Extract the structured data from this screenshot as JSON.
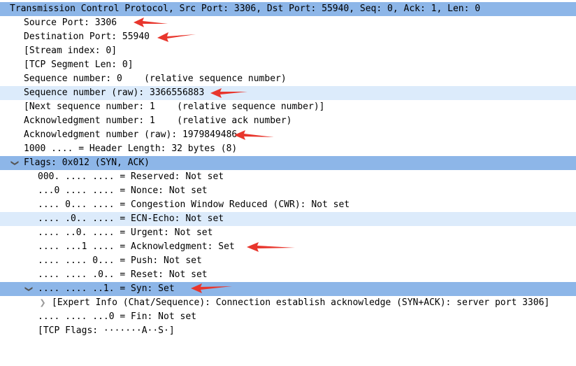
{
  "rows": [
    {
      "text": "Transmission Control Protocol, Src Port: 3306, Dst Port: 55940, Seq: 0, Ack: 1, Len: 0"
    },
    {
      "text": "Source Port: 3306"
    },
    {
      "text": "Destination Port: 55940"
    },
    {
      "text": "[Stream index: 0]"
    },
    {
      "text": "[TCP Segment Len: 0]"
    },
    {
      "text": "Sequence number: 0    (relative sequence number)"
    },
    {
      "text": "Sequence number (raw): 3366556883"
    },
    {
      "text": "[Next sequence number: 1    (relative sequence number)]"
    },
    {
      "text": "Acknowledgment number: 1    (relative ack number)"
    },
    {
      "text": "Acknowledgment number (raw): 1979849486"
    },
    {
      "text": "1000 .... = Header Length: 32 bytes (8)"
    },
    {
      "text": "Flags: 0x012 (SYN, ACK)"
    },
    {
      "text": "000. .... .... = Reserved: Not set"
    },
    {
      "text": "...0 .... .... = Nonce: Not set"
    },
    {
      "text": ".... 0... .... = Congestion Window Reduced (CWR): Not set"
    },
    {
      "text": ".... .0.. .... = ECN-Echo: Not set"
    },
    {
      "text": ".... ..0. .... = Urgent: Not set"
    },
    {
      "text": ".... ...1 .... = Acknowledgment: Set"
    },
    {
      "text": ".... .... 0... = Push: Not set"
    },
    {
      "text": ".... .... .0.. = Reset: Not set"
    },
    {
      "text": ".... .... ..1. = Syn: Set"
    },
    {
      "text": "[Expert Info (Chat/Sequence): Connection establish acknowledge (SYN+ACK): server port 3306]"
    },
    {
      "text": ".... .... ...0 = Fin: Not set"
    },
    {
      "text": "[TCP Flags: ·······A··S·]"
    }
  ],
  "colors": {
    "selection": "#8db6e8",
    "row_highlight": "#dcebfb",
    "annotation_arrow": "#e8362d"
  },
  "icons": {
    "expanded": "chevron-down-icon",
    "collapsed": "chevron-right-icon",
    "annotation": "red-arrow-icon"
  }
}
